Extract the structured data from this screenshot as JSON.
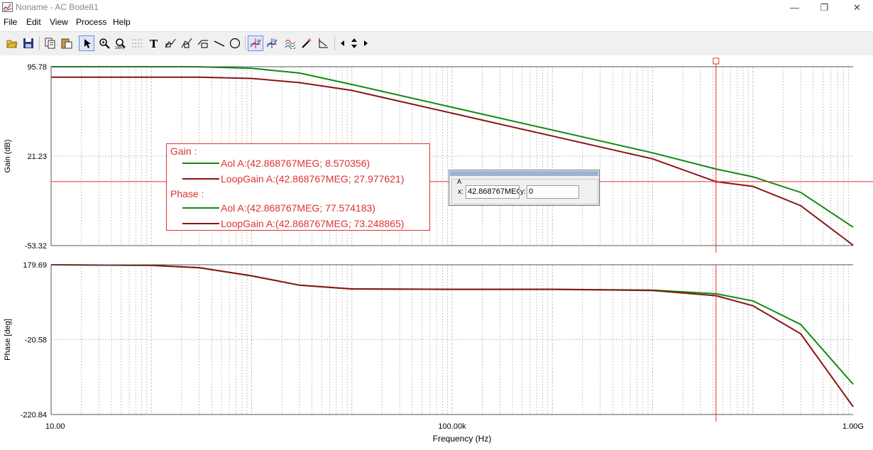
{
  "window": {
    "title": "Noname - AC Bode81",
    "minimize": "—",
    "restore": "❐",
    "close": "✕"
  },
  "menu": [
    "File",
    "Edit",
    "View",
    "Process",
    "Help"
  ],
  "toolbar": [
    "open-icon",
    "save-icon",
    "copy-icon",
    "paste-icon",
    "select-icon",
    "zoom-icon",
    "zoom-fit-icon",
    "grid-icon",
    "text-icon",
    "label-icon",
    "label2-icon",
    "label3-icon",
    "line-icon",
    "circle-icon",
    "cursor-a-icon",
    "cursor-b-icon",
    "curves-icon",
    "probe-icon",
    "marker-icon",
    "left-arrow-icon",
    "updown-icon",
    "right-arrow-icon"
  ],
  "legend": {
    "gain_header": "Gain :",
    "phase_header": "Phase :",
    "gain_aol": "Aol   A:(42.868767MEG; 8.570356)",
    "gain_loop": "LoopGain   A:(42.868767MEG; 27.977621)",
    "phase_aol": "Aol   A:(42.868767MEG; 77.574183)",
    "phase_loop": "LoopGain   A:(42.868767MEG; 73.248865)"
  },
  "cursor_box": {
    "title": "A",
    "x_label": "x:",
    "y_label": "y:",
    "x_value": "42.868767MEG",
    "y_value": "0"
  },
  "colors": {
    "aol": "#0f8a0f",
    "loop": "#8b1414",
    "cursor": "#ee2d2d",
    "grid": "#c6c6c6"
  },
  "chart_data": [
    {
      "type": "line",
      "xscale": "log",
      "xlim": [
        10,
        1000000000
      ],
      "ylim": [
        -53.32,
        95.78
      ],
      "ylabel": "Gain (dB)",
      "ytick_labels": [
        "95.78",
        "21.23",
        "-53.32"
      ],
      "ytick_values": [
        95.78,
        21.23,
        -53.32
      ],
      "grid": true,
      "series": [
        {
          "name": "Aol",
          "x": [
            10,
            100,
            300,
            1000,
            3000,
            10000,
            100000,
            1000000,
            10000000,
            42868767,
            100000000,
            300000000,
            1000000000
          ],
          "y": [
            95.78,
            95.78,
            95.7,
            94.5,
            90.5,
            81,
            62,
            43,
            24,
            10.5,
            4,
            -9,
            -38
          ]
        },
        {
          "name": "LoopGain",
          "x": [
            10,
            100,
            300,
            1000,
            3000,
            10000,
            100000,
            1000000,
            10000000,
            42868767,
            100000000,
            300000000,
            1000000000
          ],
          "y": [
            87,
            87,
            87,
            86,
            82.5,
            76,
            57,
            38,
            19,
            0,
            -4,
            -20,
            -53
          ]
        }
      ],
      "cursor": {
        "label": "A",
        "x": 42868767,
        "y": 0
      }
    },
    {
      "type": "line",
      "xscale": "log",
      "xlim": [
        10,
        1000000000
      ],
      "ylim": [
        -220.84,
        179.69
      ],
      "xlabel": "Frequency (Hz)",
      "ylabel": "Phase [deg]",
      "xtick_labels": [
        "10.00",
        "100.00k",
        "1.00G"
      ],
      "xtick_values": [
        10,
        100000,
        1000000000
      ],
      "ytick_labels": [
        "179.69",
        "-20.58",
        "-220.84"
      ],
      "ytick_values": [
        179.69,
        -20.58,
        -220.84
      ],
      "grid": true,
      "series": [
        {
          "name": "Aol",
          "x": [
            10,
            100,
            300,
            1000,
            3000,
            10000,
            100000,
            1000000,
            10000000,
            42868767,
            100000000,
            300000000,
            1000000000
          ],
          "y": [
            179.69,
            178,
            172,
            150,
            125,
            115,
            114,
            114,
            112,
            102,
            83,
            20,
            -140
          ]
        },
        {
          "name": "LoopGain",
          "x": [
            10,
            100,
            300,
            1000,
            3000,
            10000,
            100000,
            1000000,
            10000000,
            42868767,
            100000000,
            300000000,
            1000000000
          ],
          "y": [
            179.69,
            178,
            172,
            150,
            125,
            115,
            114,
            114,
            111,
            97,
            70,
            -5,
            -200
          ]
        }
      ],
      "cursor": {
        "label": "A",
        "x": 42868767
      }
    }
  ]
}
